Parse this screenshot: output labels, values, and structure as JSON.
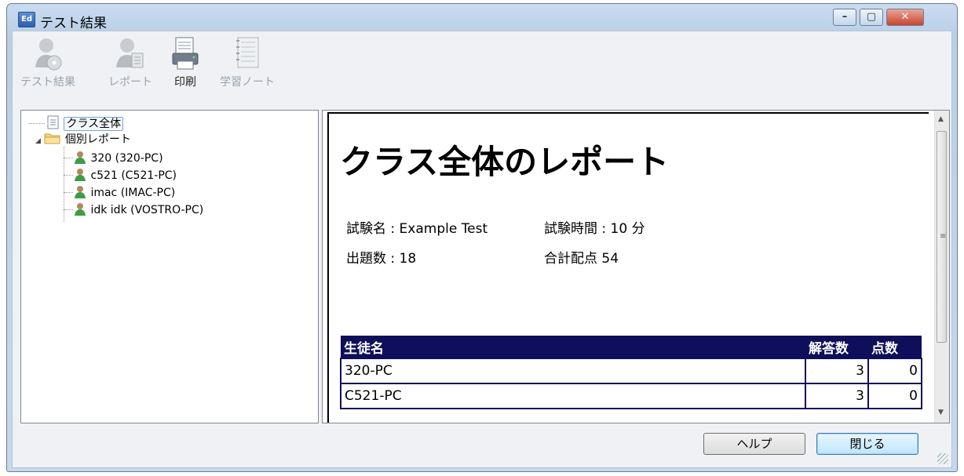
{
  "window": {
    "title": "テスト結果",
    "app_icon_text": "Ed",
    "controls": {
      "minimize": "–",
      "maximize": "▢",
      "close": "✕"
    }
  },
  "toolbar": {
    "items": [
      {
        "label": "テスト結果",
        "icon": "user-disc-icon",
        "enabled": false
      },
      {
        "label": "レポート",
        "icon": "user-report-icon",
        "enabled": false
      },
      {
        "label": "印刷",
        "icon": "print-icon",
        "enabled": true
      },
      {
        "label": "学習ノート",
        "icon": "notebook-icon",
        "enabled": false
      }
    ]
  },
  "tree": {
    "class_item": "クラス全体",
    "individual_folder": "個別レポート",
    "students": [
      "320 (320-PC)",
      "c521 (C521-PC)",
      "imac (IMAC-PC)",
      "idk idk (VOSTRO-PC)"
    ]
  },
  "report": {
    "title": "クラス全体のレポート",
    "exam_name": "試験名 : Example Test",
    "exam_time": "試験時間 : 10 分",
    "question_count": "出題数 : 18",
    "total_points": "合計配点 54",
    "table": {
      "headers": [
        "生徒名",
        "解答数",
        "点数"
      ],
      "rows": [
        [
          "320-PC",
          "3",
          "0"
        ],
        [
          "C521-PC",
          "3",
          "0"
        ]
      ]
    }
  },
  "buttons": {
    "help": "ヘルプ",
    "close": "閉じる"
  },
  "colors": {
    "table_header_bg": "#0e0e5a",
    "accent": "#3c7fb1"
  }
}
